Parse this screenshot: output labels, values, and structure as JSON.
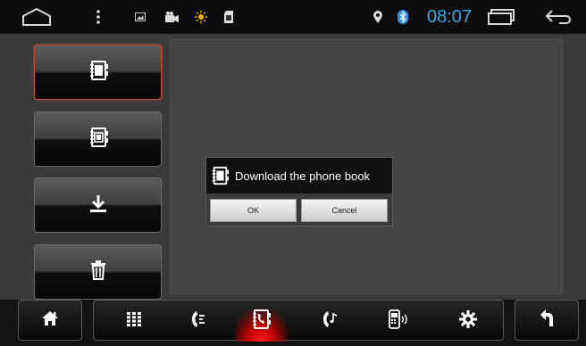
{
  "status_bar": {
    "icons": [
      "home-outline-icon",
      "overflow-menu-icon",
      "picture-icon",
      "camera-icon",
      "brightness-icon",
      "sd-card-icon",
      "location-icon",
      "bluetooth-icon",
      "recent-apps-icon",
      "back-arrow-icon"
    ],
    "time": "08:07",
    "accent": "#3aa8e8"
  },
  "sidebar": {
    "items": [
      {
        "icon": "phonebook-icon",
        "active": true
      },
      {
        "icon": "phonebook-sim-icon",
        "active": false
      },
      {
        "icon": "download-icon",
        "active": false
      },
      {
        "icon": "trash-icon",
        "active": false
      }
    ]
  },
  "dialog": {
    "icon": "phonebook-icon",
    "title": "Download the phone book",
    "ok_label": "OK",
    "cancel_label": "Cancel"
  },
  "dock": {
    "home_icon": "home-icon",
    "back_icon": "return-icon",
    "items": [
      "dialpad-icon",
      "call-log-icon",
      "contacts-icon",
      "music-call-icon",
      "phone-device-icon",
      "settings-icon"
    ],
    "active_index": 2,
    "active_color": "#ff1a1a"
  }
}
